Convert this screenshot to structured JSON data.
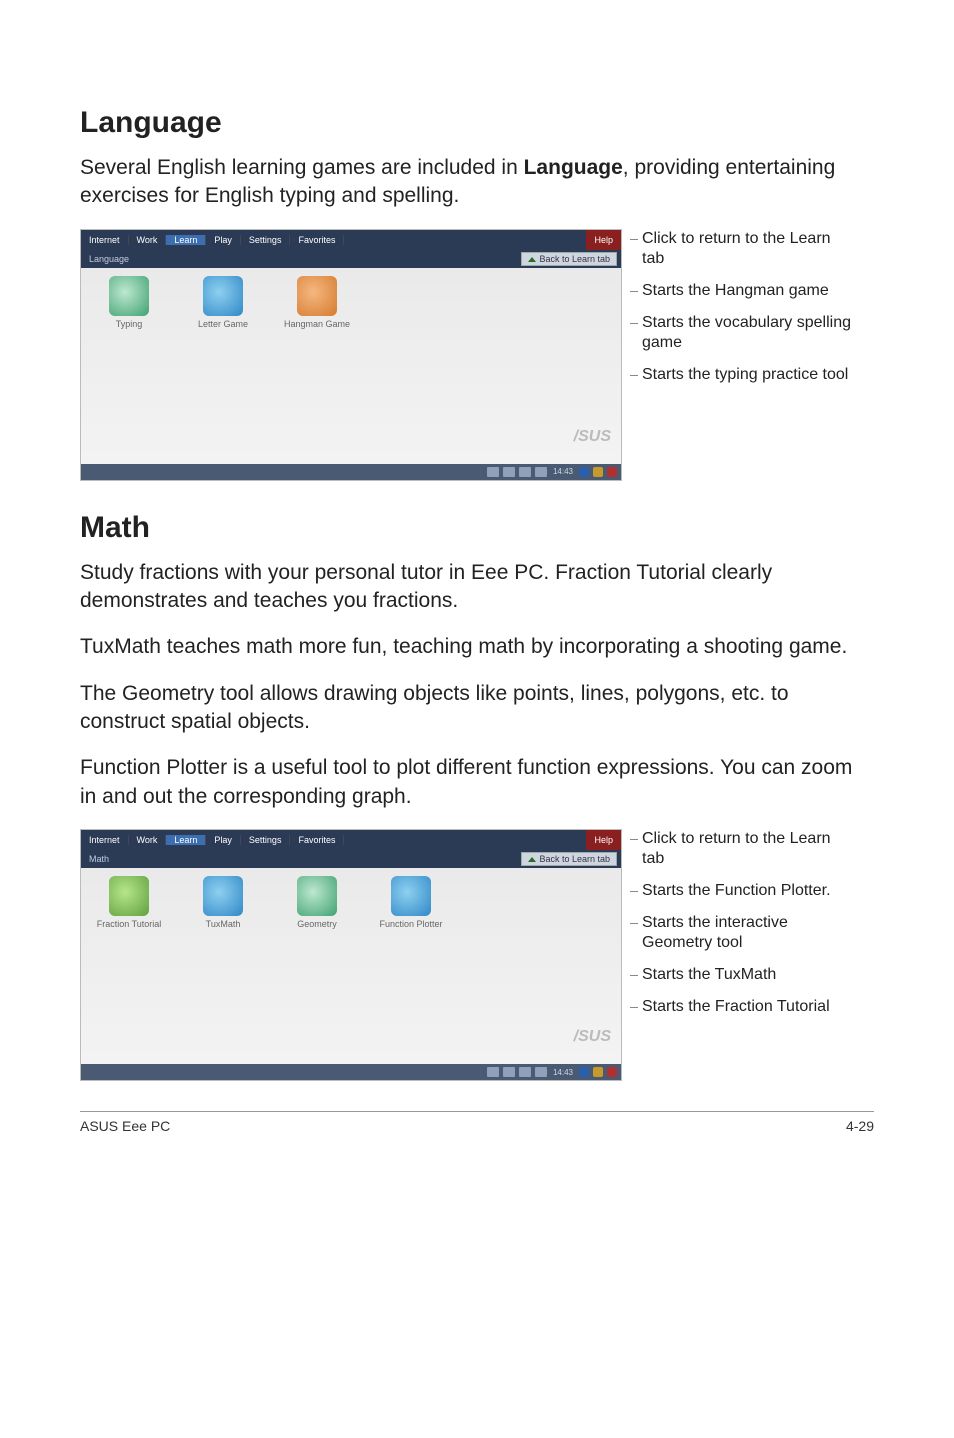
{
  "sections": {
    "language": {
      "title": "Language",
      "paragraphs": [
        "Several English learning games are included in <b>Language</b>, providing entertaining exercises for English typing and spelling."
      ],
      "screenshot": {
        "tabs": [
          "Internet",
          "Work",
          "Learn",
          "Play",
          "Settings",
          "Favorites"
        ],
        "active_tab": "Learn",
        "help": "Help",
        "breadcrumb": "Language",
        "back": "Back to Learn tab",
        "apps": [
          {
            "label": "Typing"
          },
          {
            "label": "Letter Game"
          },
          {
            "label": "Hangman Game"
          }
        ],
        "logo": "/SUS",
        "time": "14:43"
      },
      "annotations": [
        "Click to return to the Learn tab",
        "Starts the Hangman game",
        "Starts the vocabulary spelling game",
        "Starts the typing practice tool"
      ]
    },
    "math": {
      "title": "Math",
      "paragraphs": [
        "Study fractions with your personal tutor in Eee PC. Fraction Tutorial clearly demonstrates and teaches you fractions.",
        "TuxMath teaches math more fun, teaching math by incorporating a shooting game.",
        "The Geometry tool allows drawing objects like points, lines, polygons, etc. to construct spatial objects.",
        "Function Plotter is a useful tool to plot different function expressions. You can zoom in and out the corresponding graph."
      ],
      "screenshot": {
        "tabs": [
          "Internet",
          "Work",
          "Learn",
          "Play",
          "Settings",
          "Favorites"
        ],
        "active_tab": "Learn",
        "help": "Help",
        "breadcrumb": "Math",
        "back": "Back to Learn tab",
        "apps": [
          {
            "label": "Fraction Tutorial"
          },
          {
            "label": "TuxMath"
          },
          {
            "label": "Geometry"
          },
          {
            "label": "Function Plotter"
          }
        ],
        "logo": "/SUS",
        "time": "14:43"
      },
      "annotations": [
        "Click to return to the Learn tab",
        "Starts the Function Plotter.",
        "Starts the interactive Geometry tool",
        "Starts the TuxMath",
        "Starts the Fraction Tutorial"
      ]
    }
  },
  "footer": {
    "left": "ASUS Eee PC",
    "right": "4-29"
  }
}
